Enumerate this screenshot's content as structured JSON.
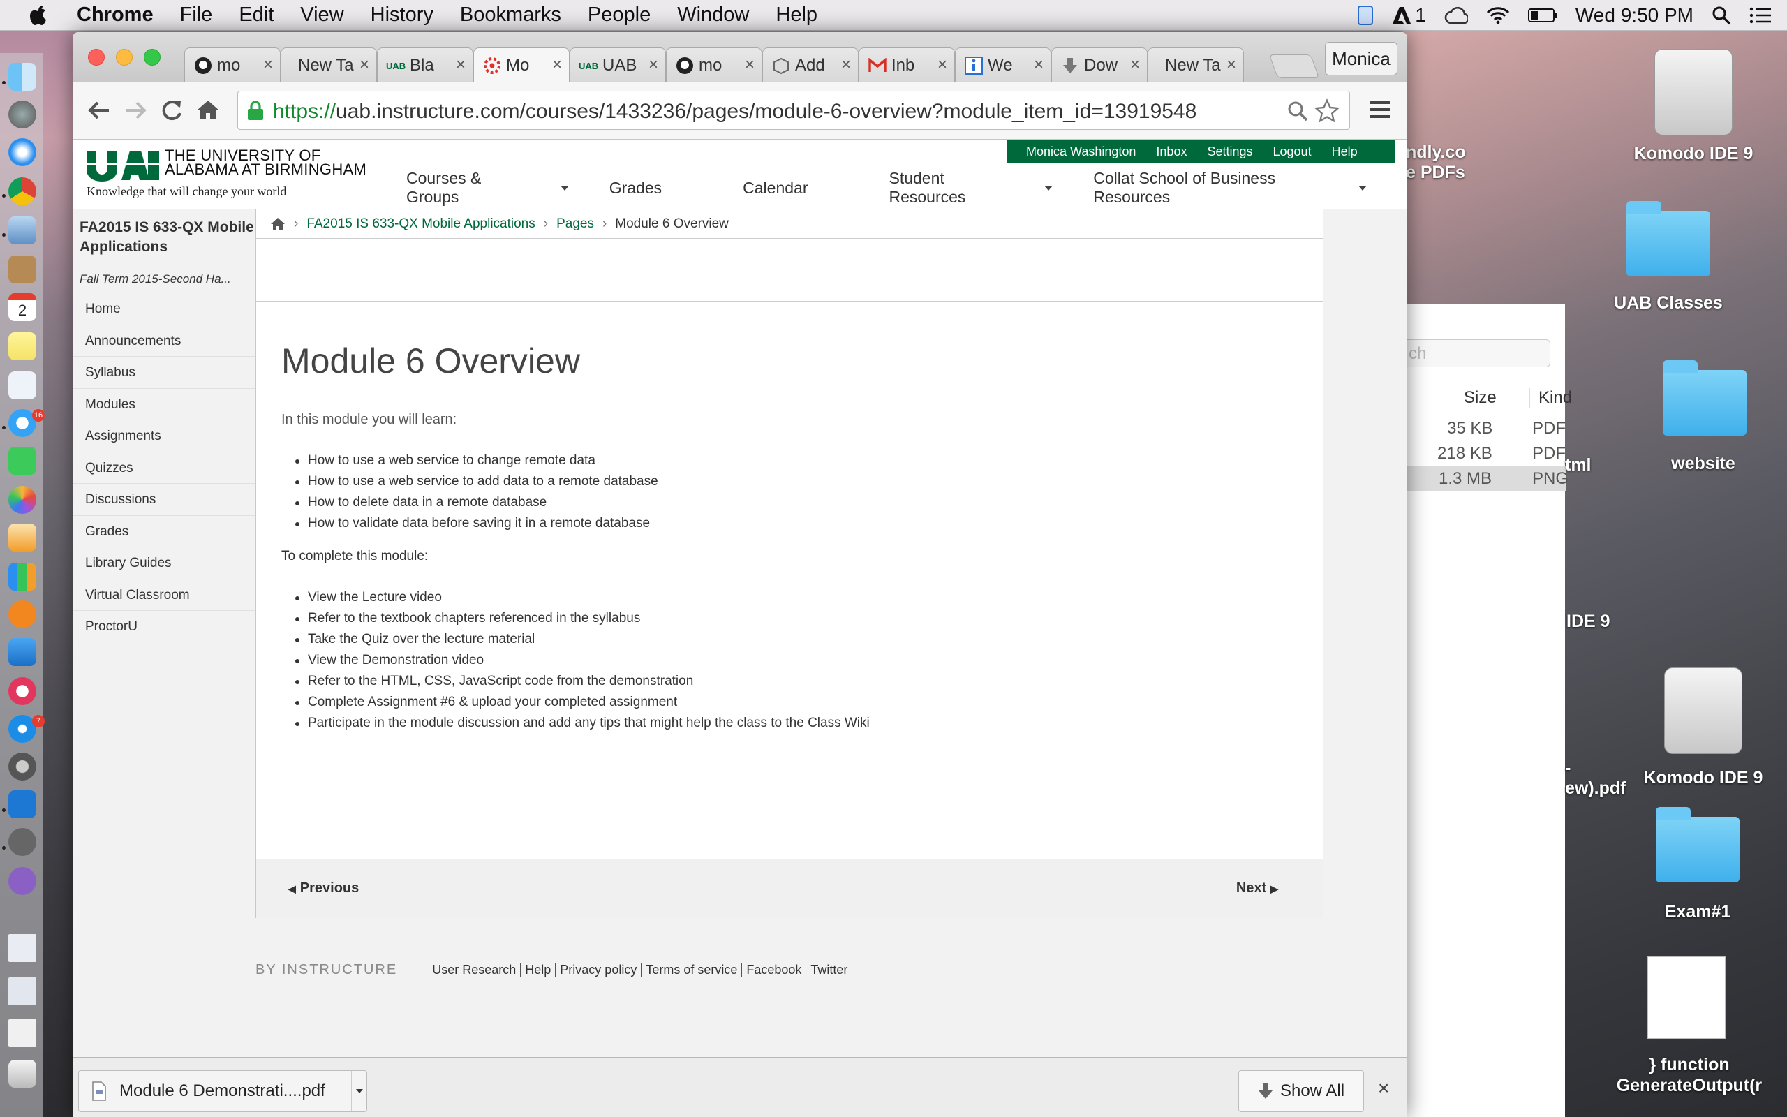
{
  "menubar": {
    "app": "Chrome",
    "items": [
      "File",
      "Edit",
      "View",
      "History",
      "Bookmarks",
      "People",
      "Window",
      "Help"
    ],
    "adobe_count": "1",
    "clock": "Wed 9:50 PM"
  },
  "dock": {
    "calendar_day": "2",
    "messages_badge": "16",
    "appstore_badge": "7"
  },
  "tabs": [
    {
      "label": "mo",
      "icon": "github-icon"
    },
    {
      "label": "New Ta",
      "icon": ""
    },
    {
      "label": "Bla",
      "icon": "uab-icon"
    },
    {
      "label": "Mo",
      "icon": "canvas-icon"
    },
    {
      "label": "UAB",
      "icon": "uab-icon"
    },
    {
      "label": "mo",
      "icon": "github-icon"
    },
    {
      "label": "Add",
      "icon": "package-icon"
    },
    {
      "label": "Inb",
      "icon": "gmail-icon"
    },
    {
      "label": "We",
      "icon": "info-icon"
    },
    {
      "label": "Dow",
      "icon": "download-icon"
    },
    {
      "label": "New Ta",
      "icon": ""
    }
  ],
  "profile": "Monica",
  "address": {
    "scheme": "https://",
    "rest": "uab.instructure.com/courses/1433236/pages/module-6-overview?module_item_id=13919548"
  },
  "header": {
    "logo_line1": "THE UNIVERSITY OF",
    "logo_line2": "ALABAMA AT BIRMINGHAM",
    "tagline": "Knowledge that will change your world",
    "nav": [
      "Courses & Groups",
      "Grades",
      "Calendar",
      "Student Resources",
      "Collat School of Business Resources"
    ],
    "user_links": [
      "Monica Washington",
      "Inbox",
      "Settings",
      "Logout",
      "Help"
    ]
  },
  "course": {
    "title": "FA2015 IS 633-QX Mobile Applications",
    "term": "Fall Term 2015-Second Ha...",
    "nav": [
      "Home",
      "Announcements",
      "Syllabus",
      "Modules",
      "Assignments",
      "Quizzes",
      "Discussions",
      "Grades",
      "Library Guides",
      "Virtual Classroom",
      "ProctorU"
    ]
  },
  "breadcrumb": {
    "course": "FA2015 IS 633-QX Mobile Applications",
    "pages": "Pages",
    "current": "Module 6 Overview"
  },
  "content": {
    "title": "Module 6 Overview",
    "intro": "In this module you will learn:",
    "learn": [
      "How to use a web service to change remote data",
      "How to use a web service to add data to a remote database",
      "How to delete data in a remote database",
      "How to validate data before saving it in a remote database"
    ],
    "complete_heading": "To complete this module:",
    "tasks": [
      "View the Lecture video",
      "Refer to the textbook chapters referenced in the syllabus",
      "Take the Quiz over the lecture material",
      "View the Demonstration video",
      "Refer to the HTML, CSS, JavaScript code from the demonstration",
      "Complete Assignment #6 & upload your completed assignment",
      "Participate in the module discussion and add any tips that might help the class to the Class Wiki"
    ],
    "previous": "Previous",
    "next": "Next"
  },
  "footer": {
    "brand": "BY INSTRUCTURE",
    "links": [
      "User Research",
      "Help",
      "Privacy policy",
      "Terms of service",
      "Facebook",
      "Twitter"
    ]
  },
  "downloads": {
    "file": "Module 6 Demonstrati....pdf",
    "show_all": "Show All"
  },
  "finder": {
    "search_placeholder": "ch",
    "col_size": "Size",
    "col_kind": "Kind",
    "rows": [
      {
        "size": "35 KB",
        "kind": "PDF"
      },
      {
        "size": "218 KB",
        "kind": "PDF"
      },
      {
        "size": "1.3 MB",
        "kind": "PNG"
      }
    ]
  },
  "desktop": {
    "partial_top": "ndly.co",
    "partial_top2": "e PDFs",
    "partial_html": "tml",
    "partial_ide": "IDE 9",
    "partial_pdf_a": "-",
    "partial_pdf_b": "ew).pdf",
    "icons": [
      "Komodo IDE 9",
      "UAB Classes",
      "website",
      "Komodo IDE 9",
      "Exam#1",
      "} function GenerateOutput(r"
    ]
  }
}
